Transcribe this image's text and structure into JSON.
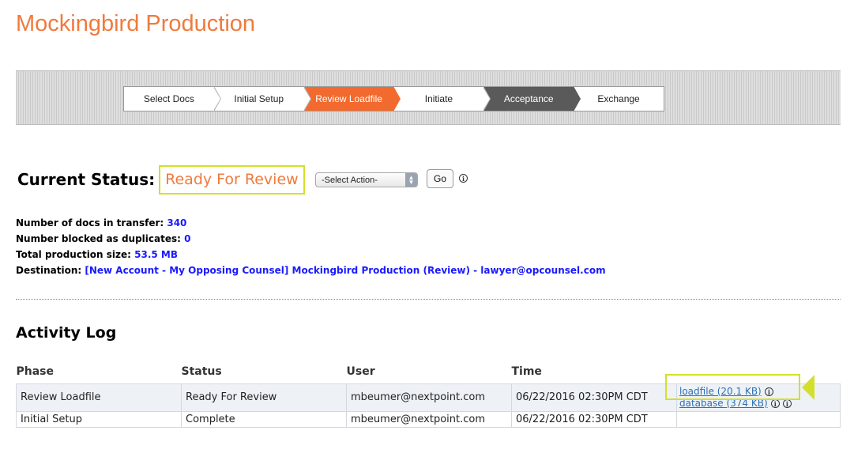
{
  "page": {
    "title": "Mockingbird Production"
  },
  "wizard": {
    "steps": [
      {
        "label": "Select Docs",
        "state": "default"
      },
      {
        "label": "Initial Setup",
        "state": "default"
      },
      {
        "label": "Review Loadfile",
        "state": "active"
      },
      {
        "label": "Initiate",
        "state": "default"
      },
      {
        "label": "Acceptance",
        "state": "dark"
      },
      {
        "label": "Exchange",
        "state": "default"
      }
    ]
  },
  "status": {
    "label": "Current Status:",
    "value": "Ready For Review",
    "action_select": "-Select Action-",
    "go_label": "Go",
    "info_glyph": "i"
  },
  "facts": {
    "docs_label": "Number of docs in transfer:",
    "docs_value": "340",
    "blocked_label": "Number blocked as duplicates:",
    "blocked_value": "0",
    "size_label": "Total production size:",
    "size_value": "53.5 MB",
    "destination_label": "Destination:",
    "destination_value": "[New Account - My Opposing Counsel] Mockingbird Production (Review) - lawyer@opcounsel.com"
  },
  "activity_log": {
    "title": "Activity Log",
    "headers": {
      "phase": "Phase",
      "status": "Status",
      "user": "User",
      "time": "Time"
    },
    "rows": [
      {
        "phase": "Review Loadfile",
        "status": "Ready For Review",
        "user": "mbeumer@nextpoint.com",
        "time": "06/22/2016 02:30PM CDT",
        "files": [
          "loadfile (20.1 KB)",
          "database (374 KB)"
        ]
      },
      {
        "phase": "Initial Setup",
        "status": "Complete",
        "user": "mbeumer@nextpoint.com",
        "time": "06/22/2016 02:30PM CDT"
      }
    ]
  },
  "colors": {
    "brand_orange": "#f07a3c",
    "active_step": "#f26a2e",
    "highlight": "#d4df2b",
    "value_blue": "#1a1aff",
    "status_red": "#e2231a",
    "status_green": "#1a7a1a"
  },
  "icons": {
    "info": "info-circle-icon",
    "select_arrows": "up-down-arrows-icon"
  }
}
